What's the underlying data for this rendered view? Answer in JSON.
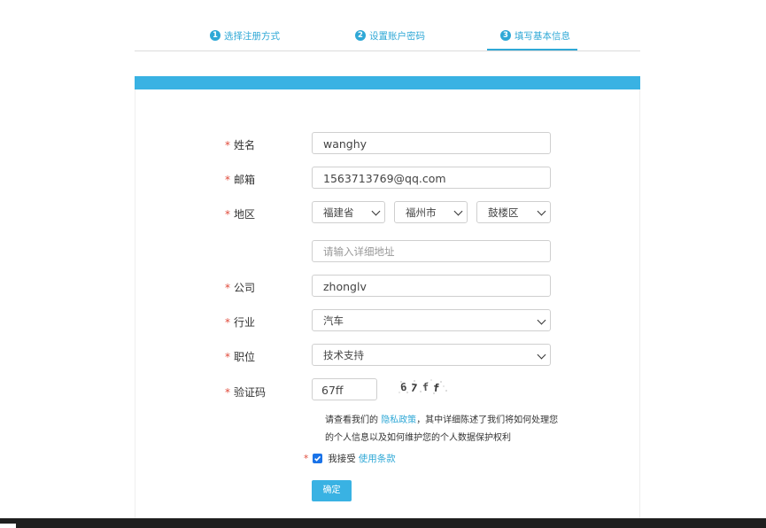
{
  "steps": [
    {
      "num": "1",
      "label": "选择注册方式"
    },
    {
      "num": "2",
      "label": "设置账户密码"
    },
    {
      "num": "3",
      "label": "填写基本信息"
    }
  ],
  "form": {
    "required_mark": "*",
    "name": {
      "label": "姓名",
      "value": "wanghy"
    },
    "email": {
      "label": "邮箱",
      "value": "1563713769@qq.com"
    },
    "region": {
      "label": "地区",
      "province": "福建省",
      "city": "福州市",
      "district": "鼓楼区"
    },
    "address": {
      "placeholder": "请输入详细地址"
    },
    "company": {
      "label": "公司",
      "value": "zhonglv"
    },
    "industry": {
      "label": "行业",
      "value": "汽车"
    },
    "position": {
      "label": "职位",
      "value": "技术支持"
    },
    "captcha": {
      "label": "验证码",
      "value": "67ff",
      "image_text": "67ff"
    }
  },
  "notice": {
    "prefix": "请查看我们的",
    "link": "隐私政策",
    "suffix": "，其中详细陈述了我们将如何处理您的个人信息以及如何维护您的个人数据保护权利"
  },
  "agree": {
    "checked": true,
    "text": "我接受",
    "link": "使用条款"
  },
  "confirm_label": "确定",
  "colors": {
    "accent": "#39b2e3",
    "link": "#2fa8d6",
    "required": "#e04a3a",
    "checkbox": "#1a73e8"
  }
}
